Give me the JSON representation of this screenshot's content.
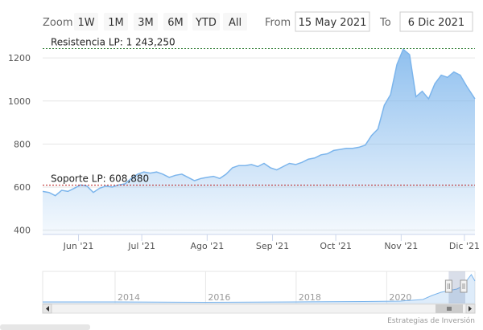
{
  "range_selector": {
    "zoom_label": "Zoom",
    "buttons": [
      "1W",
      "1M",
      "3M",
      "6M",
      "YTD",
      "All"
    ],
    "from_label": "From",
    "from_value": "15 May 2021",
    "to_label": "To",
    "to_value": "6 Dic 2021"
  },
  "credit": "Estrategias de Inversión",
  "colors": {
    "line": "#7cb5ec",
    "resistance": "#2e7d32",
    "support": "#b71c1c"
  },
  "chart_data": {
    "type": "area",
    "title": "",
    "xlabel": "",
    "ylabel": "",
    "x_range": [
      "2021-05-15",
      "2021-12-06"
    ],
    "ylim": [
      380,
      1290
    ],
    "yticks": [
      400,
      600,
      800,
      1000,
      1200
    ],
    "xticks": [
      {
        "date": "2021-06-01",
        "label": "Jun '21"
      },
      {
        "date": "2021-07-01",
        "label": "Jul '21"
      },
      {
        "date": "2021-08-01",
        "label": "Ago '21"
      },
      {
        "date": "2021-09-01",
        "label": "Sep '21"
      },
      {
        "date": "2021-10-01",
        "label": "Oct '21"
      },
      {
        "date": "2021-11-01",
        "label": "Nov '21"
      },
      {
        "date": "2021-12-01",
        "label": "Dic '21"
      }
    ],
    "grid": true,
    "series": [
      {
        "points": [
          [
            "2021-05-15",
            580
          ],
          [
            "2021-05-18",
            575
          ],
          [
            "2021-05-21",
            560
          ],
          [
            "2021-05-24",
            585
          ],
          [
            "2021-05-27",
            580
          ],
          [
            "2021-05-30",
            595
          ],
          [
            "2021-06-02",
            610
          ],
          [
            "2021-06-05",
            605
          ],
          [
            "2021-06-08",
            575
          ],
          [
            "2021-06-11",
            595
          ],
          [
            "2021-06-14",
            605
          ],
          [
            "2021-06-17",
            600
          ],
          [
            "2021-06-20",
            610
          ],
          [
            "2021-06-23",
            615
          ],
          [
            "2021-06-26",
            640
          ],
          [
            "2021-06-29",
            660
          ],
          [
            "2021-07-02",
            670
          ],
          [
            "2021-07-05",
            665
          ],
          [
            "2021-07-08",
            670
          ],
          [
            "2021-07-11",
            660
          ],
          [
            "2021-07-14",
            645
          ],
          [
            "2021-07-17",
            655
          ],
          [
            "2021-07-20",
            660
          ],
          [
            "2021-07-23",
            645
          ],
          [
            "2021-07-26",
            630
          ],
          [
            "2021-07-29",
            640
          ],
          [
            "2021-08-01",
            645
          ],
          [
            "2021-08-04",
            650
          ],
          [
            "2021-08-07",
            640
          ],
          [
            "2021-08-10",
            660
          ],
          [
            "2021-08-13",
            690
          ],
          [
            "2021-08-16",
            700
          ],
          [
            "2021-08-19",
            700
          ],
          [
            "2021-08-22",
            705
          ],
          [
            "2021-08-25",
            695
          ],
          [
            "2021-08-28",
            710
          ],
          [
            "2021-08-31",
            690
          ],
          [
            "2021-09-03",
            680
          ],
          [
            "2021-09-06",
            695
          ],
          [
            "2021-09-09",
            710
          ],
          [
            "2021-09-12",
            705
          ],
          [
            "2021-09-15",
            715
          ],
          [
            "2021-09-18",
            730
          ],
          [
            "2021-09-21",
            735
          ],
          [
            "2021-09-24",
            750
          ],
          [
            "2021-09-27",
            755
          ],
          [
            "2021-09-30",
            770
          ],
          [
            "2021-10-03",
            775
          ],
          [
            "2021-10-06",
            780
          ],
          [
            "2021-10-09",
            780
          ],
          [
            "2021-10-12",
            785
          ],
          [
            "2021-10-15",
            795
          ],
          [
            "2021-10-18",
            840
          ],
          [
            "2021-10-21",
            870
          ],
          [
            "2021-10-24",
            980
          ],
          [
            "2021-10-27",
            1030
          ],
          [
            "2021-10-30",
            1170
          ],
          [
            "2021-11-02",
            1240
          ],
          [
            "2021-11-05",
            1215
          ],
          [
            "2021-11-08",
            1020
          ],
          [
            "2021-11-11",
            1045
          ],
          [
            "2021-11-14",
            1010
          ],
          [
            "2021-11-17",
            1080
          ],
          [
            "2021-11-20",
            1120
          ],
          [
            "2021-11-23",
            1110
          ],
          [
            "2021-11-26",
            1135
          ],
          [
            "2021-11-29",
            1120
          ],
          [
            "2021-12-02",
            1070
          ],
          [
            "2021-12-06",
            1010
          ]
        ]
      }
    ],
    "annotations": [
      {
        "label": "Resistencia LP: 1 243,250",
        "value": 1243.25
      },
      {
        "label": "Soporte LP: 608,880",
        "value": 608.88
      }
    ],
    "navigator": {
      "tick_labels": [
        "2014",
        "2016",
        "2018",
        "2020"
      ],
      "selected_range": [
        "2021-05-15",
        "2021-12-06"
      ]
    }
  }
}
